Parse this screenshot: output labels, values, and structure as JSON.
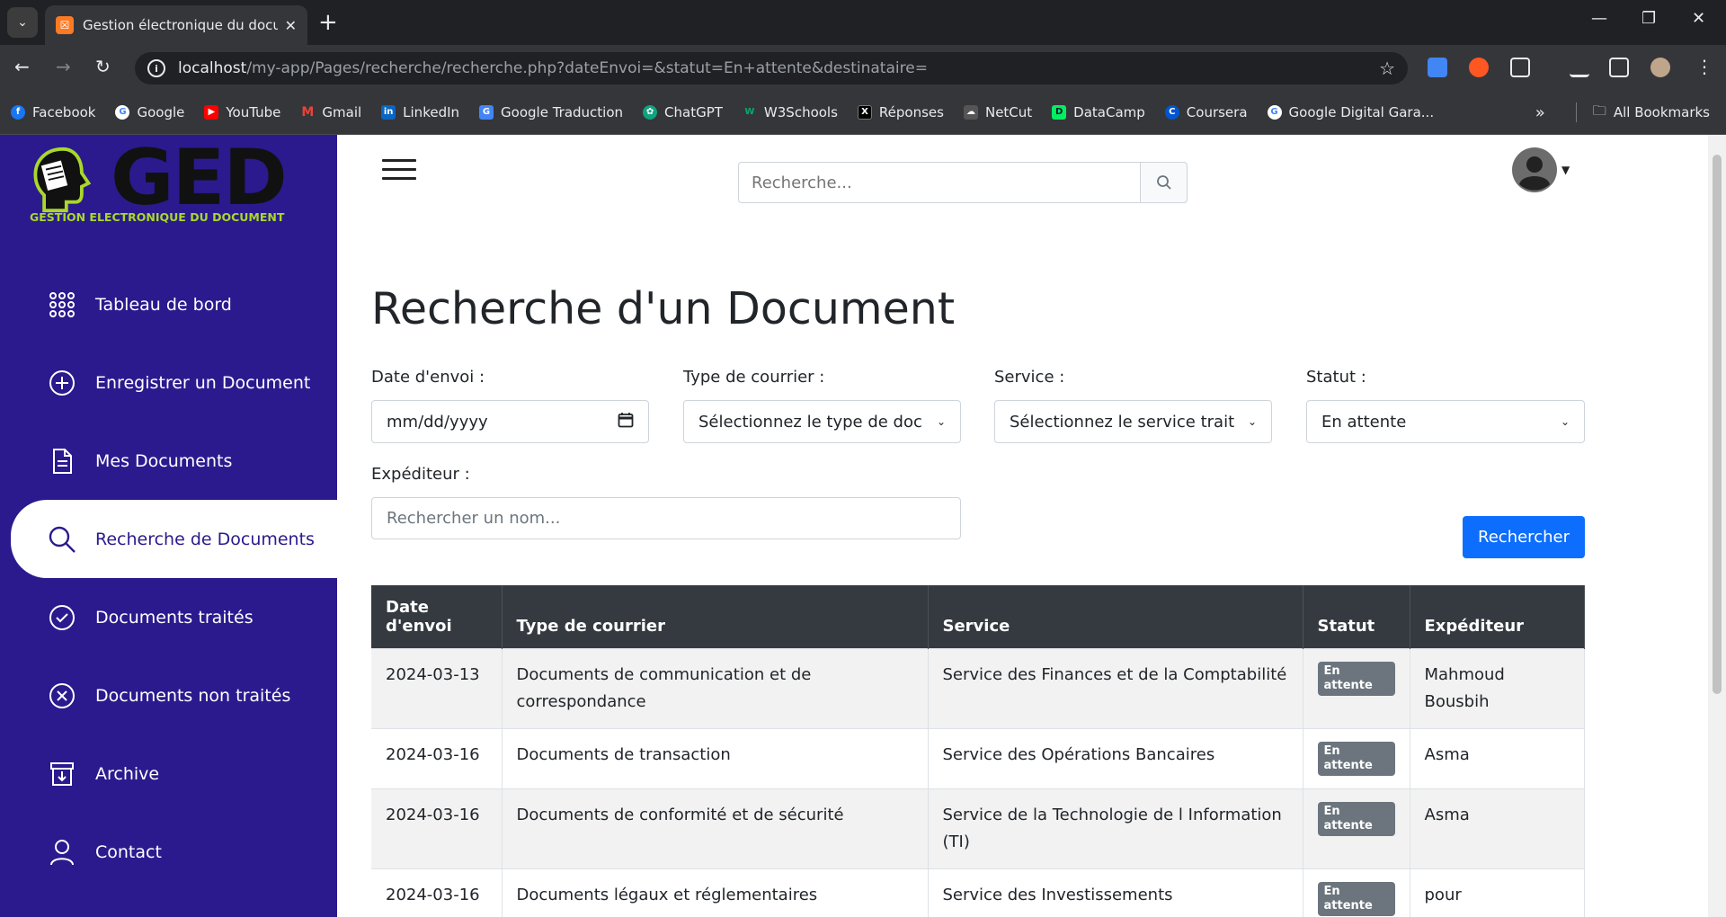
{
  "browser": {
    "tab_title": "Gestion électronique du docum",
    "url_host": "localhost",
    "url_path": "/my-app/Pages/recherche/recherche.php?dateEnvoi=&statut=En+attente&destinataire=",
    "bookmarks": [
      {
        "label": "Facebook",
        "color": "#1877f2"
      },
      {
        "label": "Google",
        "color": "#ea4335"
      },
      {
        "label": "YouTube",
        "color": "#ff0000"
      },
      {
        "label": "Gmail",
        "color": "#ea4335"
      },
      {
        "label": "LinkedIn",
        "color": "#0a66c2"
      },
      {
        "label": "Google Traduction",
        "color": "#4285f4"
      },
      {
        "label": "ChatGPT",
        "color": "#10a37f"
      },
      {
        "label": "W3Schools",
        "color": "#04aa6d"
      },
      {
        "label": "Réponses",
        "color": "#000000"
      },
      {
        "label": "NetCut",
        "color": "#555555"
      },
      {
        "label": "DataCamp",
        "color": "#03ef62"
      },
      {
        "label": "Coursera",
        "color": "#0056d2"
      },
      {
        "label": "Google Digital Gara...",
        "color": "#4285f4"
      }
    ],
    "all_bookmarks": "All Bookmarks"
  },
  "sidebar": {
    "logo_text": "GED",
    "logo_sub": "GESTION ELECTRONIQUE DU DOCUMENT",
    "items": [
      {
        "label": "Tableau de bord",
        "icon": "grid-icon"
      },
      {
        "label": "Enregistrer un Document",
        "icon": "plus-circle-icon"
      },
      {
        "label": "Mes Documents",
        "icon": "document-icon"
      },
      {
        "label": "Recherche de Documents",
        "icon": "search-icon",
        "active": true
      },
      {
        "label": "Documents traités",
        "icon": "check-circle-icon"
      },
      {
        "label": "Documents non traités",
        "icon": "x-circle-icon"
      },
      {
        "label": "Archive",
        "icon": "archive-icon"
      },
      {
        "label": "Contact",
        "icon": "user-icon"
      }
    ]
  },
  "header": {
    "search_placeholder": "Recherche..."
  },
  "form": {
    "title": "Recherche d'un Document",
    "date_label": "Date d'envoi :",
    "date_value": "mm/dd/yyyy",
    "type_label": "Type de courrier :",
    "type_value": "Sélectionnez le type de doc",
    "service_label": "Service :",
    "service_value": "Sélectionnez le service trait",
    "statut_label": "Statut :",
    "statut_value": "En attente",
    "expediteur_label": "Expéditeur :",
    "expediteur_placeholder": "Rechercher un nom...",
    "submit": "Rechercher"
  },
  "table": {
    "headers": [
      "Date d'envoi",
      "Type de courrier",
      "Service",
      "Statut",
      "Expéditeur"
    ],
    "rows": [
      [
        "2024-03-13",
        "Documents de communication et de correspondance",
        "Service des Finances et de la Comptabilité",
        "En attente",
        "Mahmoud Bousbih"
      ],
      [
        "2024-03-16",
        "Documents de transaction",
        "Service des Opérations Bancaires",
        "En attente",
        "Asma"
      ],
      [
        "2024-03-16",
        "Documents de conformité et de sécurité",
        "Service de la Technologie de l Information (TI)",
        "En attente",
        "Asma"
      ],
      [
        "2024-03-16",
        "Documents légaux et réglementaires",
        "Service des Investissements",
        "En attente",
        "pour"
      ]
    ]
  }
}
